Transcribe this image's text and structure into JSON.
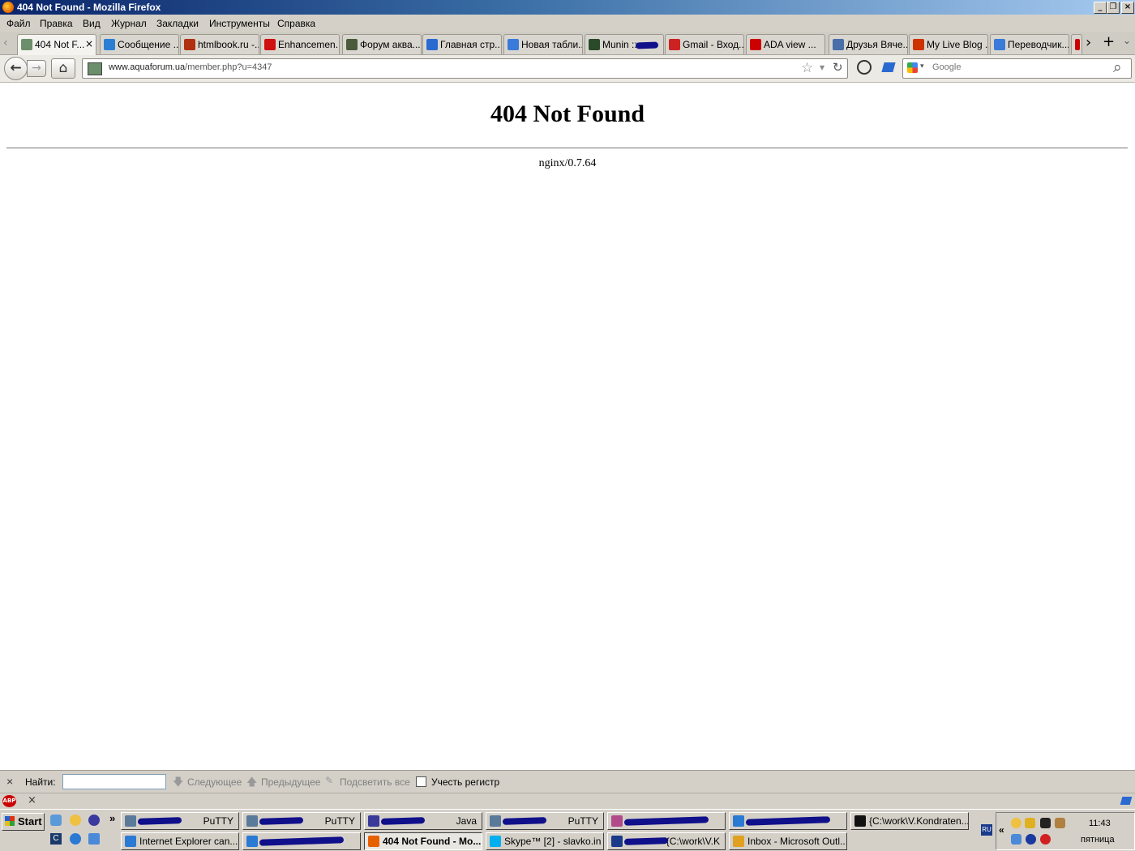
{
  "window": {
    "title": "404 Not Found - Mozilla Firefox"
  },
  "menu": [
    "Файл",
    "Правка",
    "Вид",
    "Журнал",
    "Закладки",
    "Инструменты",
    "Справка"
  ],
  "tabs": [
    {
      "label": "404 Not F...",
      "color": "#6b8e6b"
    },
    {
      "label": "Сообщение ...",
      "color": "#2a7fd4"
    },
    {
      "label": "htmlbook.ru -...",
      "color": "#b03010"
    },
    {
      "label": "Enhancemen...",
      "color": "#d01010"
    },
    {
      "label": "Форум аква...",
      "color": "#4a5a3a"
    },
    {
      "label": "Главная стр...",
      "color": "#2a6ad0"
    },
    {
      "label": "Новая табли...",
      "color": "#3a7ad8"
    },
    {
      "label": "Munin ::",
      "color": "#2a4a2a"
    },
    {
      "label": "Gmail - Вход...",
      "color": "#cc2222"
    },
    {
      "label": "ADA view ...",
      "color": "#cc0000"
    },
    {
      "label": "Друзья Вяче...",
      "color": "#4a6ea8"
    },
    {
      "label": "My Live Blog ...",
      "color": "#cc3300"
    },
    {
      "label": "Переводчик...",
      "color": "#3a7ad8"
    }
  ],
  "tab_active_close": "×",
  "tab_scroll_right": "›",
  "new_tab": "+",
  "tab_list": "⌄",
  "nav": {
    "back": "←",
    "forward": "→",
    "home": "⌂",
    "url_host": "www.aquaforum.ua",
    "url_path": "/member.php?u=4347",
    "star": "☆",
    "dropdown": "▾",
    "reload": "↻",
    "search_placeholder": "Google",
    "search_icon": "⌕"
  },
  "page": {
    "heading": "404 Not Found",
    "server": "nginx/0.7.64"
  },
  "findbar": {
    "close": "×",
    "label": "Найти:",
    "next": "Следующее",
    "prev": "Предыдущее",
    "highlight": "Подсветить все",
    "match_case": "Учесть регистр"
  },
  "addon_bar": {
    "abp": "ABP",
    "close": "×"
  },
  "taskbar": {
    "start": "Start",
    "quicklaunch_more": "»",
    "row1": [
      {
        "label": "PuTTY",
        "color": "#5a7a9a",
        "redacted": true
      },
      {
        "label": "PuTTY",
        "color": "#5a7a9a",
        "redacted": true
      },
      {
        "label": "Java",
        "color": "#3a3a9a",
        "redacted": true
      },
      {
        "label": "PuTTY",
        "color": "#5a7a9a",
        "redacted": true
      },
      {
        "label": "",
        "color": "#b04a8a",
        "redacted": true
      },
      {
        "label": "",
        "color": "#2a7ad4",
        "redacted": true
      },
      {
        "label": "{C:\\work\\V.Kondraten...",
        "color": "#111111",
        "redacted": false
      }
    ],
    "row2": [
      {
        "label": "Internet Explorer can...",
        "color": "#2a7ad4",
        "redacted": false
      },
      {
        "label": "",
        "color": "#2a7ad4",
        "redacted": true
      },
      {
        "label": "404 Not Found - Mo...",
        "color": "#e66000",
        "redacted": false,
        "active": true
      },
      {
        "label": "Skype™ [2] - slavko.in",
        "color": "#00aff0",
        "redacted": false
      },
      {
        "label": "{C:\\work\\V.K",
        "color": "#1a3a8a",
        "redacted": true
      },
      {
        "label": "Inbox - Microsoft Outl...",
        "color": "#e0a020",
        "redacted": false
      }
    ],
    "lang": "RU",
    "tray_expand": "«",
    "clock": "11:43",
    "day": "пятница"
  }
}
